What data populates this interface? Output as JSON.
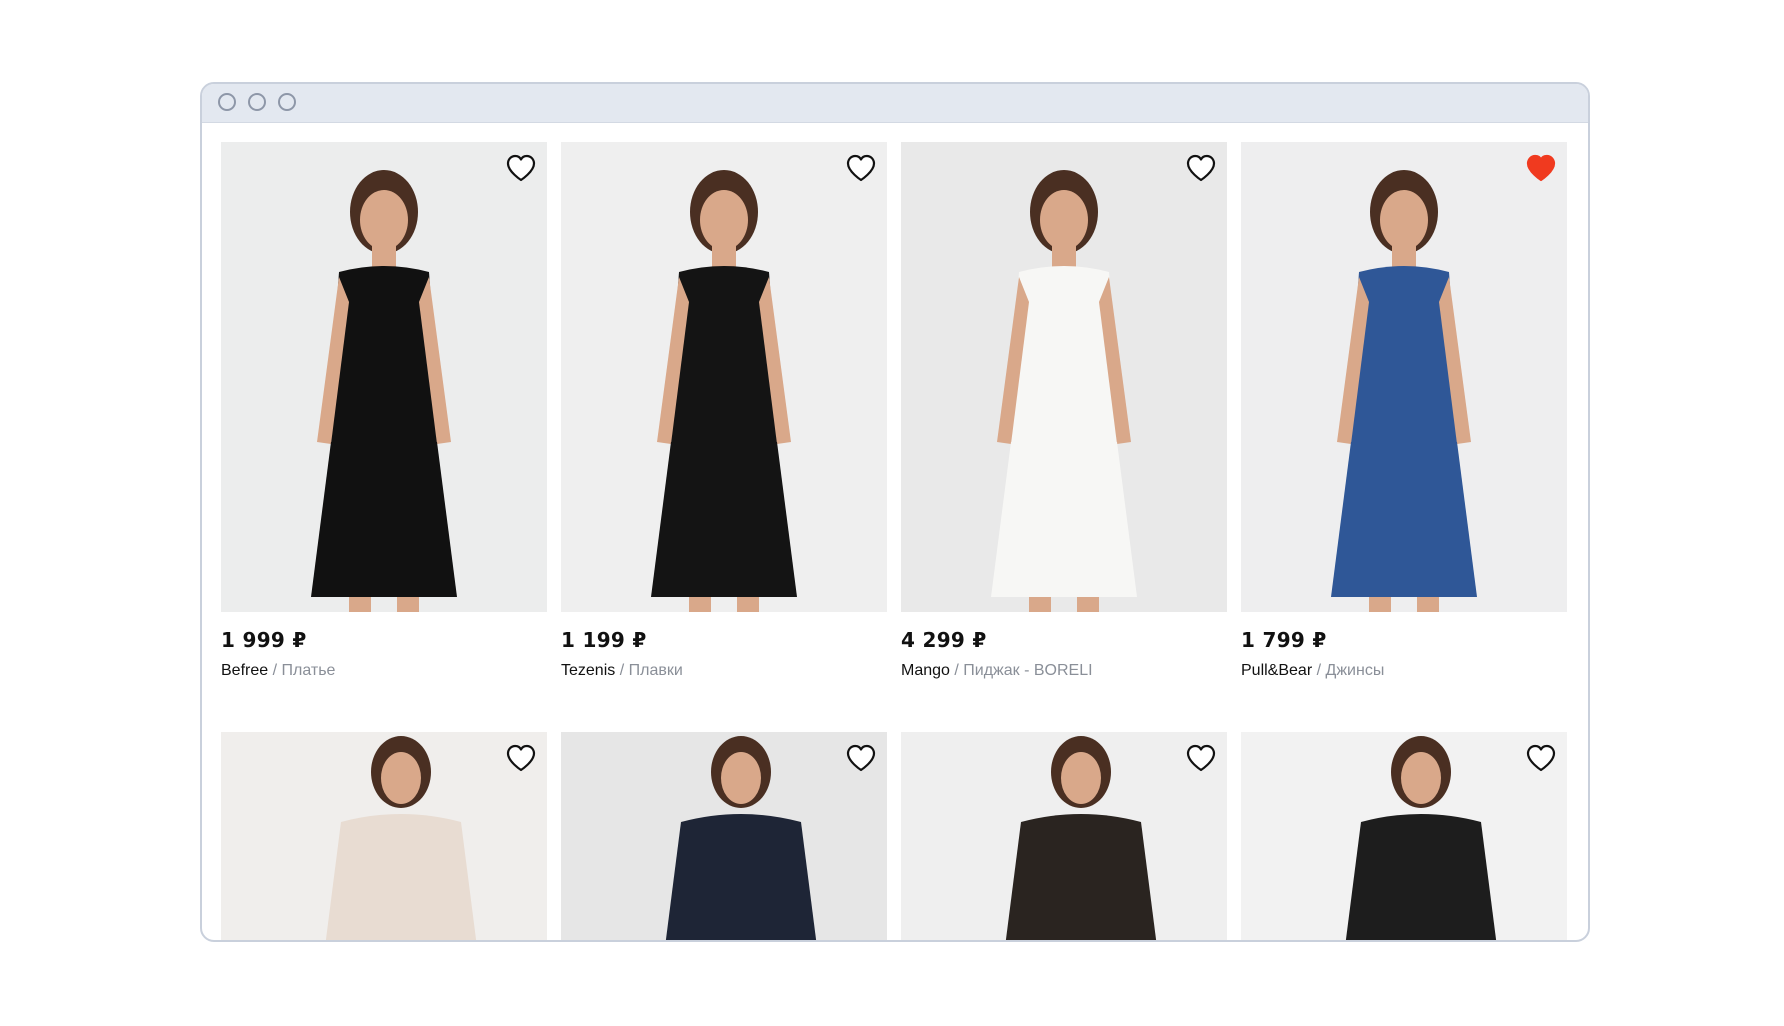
{
  "window": {
    "controls": [
      "window-dot",
      "window-dot",
      "window-dot"
    ]
  },
  "colors": {
    "titlebar": "#e3e8f0",
    "border": "#c9d0dc",
    "favorite_active": "#f03a1f",
    "muted_text": "#8a8f98"
  },
  "products": [
    {
      "price": "1 999 ₽",
      "brand": "Befree",
      "separator": "/",
      "type": "Платье",
      "favorited": false,
      "image": "black-button-dress-photo",
      "outfit_color": "#111111",
      "bg": "#eceded"
    },
    {
      "price": "1 199 ₽",
      "brand": "Tezenis",
      "separator": "/",
      "type": "Плавки",
      "favorited": false,
      "image": "black-bikini-photo",
      "outfit_color": "#141414",
      "bg": "#efefef"
    },
    {
      "price": "4 299 ₽",
      "brand": "Mango",
      "separator": "/",
      "type": "Пиджак - BORELI",
      "favorited": false,
      "image": "white-blazer-photo",
      "outfit_color": "#f7f7f5",
      "bg": "#e9e9e9"
    },
    {
      "price": "1 799 ₽",
      "brand": "Pull&Bear",
      "separator": "/",
      "type": "Джинсы",
      "favorited": true,
      "image": "blue-jeans-photo",
      "outfit_color": "#2f5797",
      "bg": "#eeeeef"
    },
    {
      "image": "beige-tshirt-photo",
      "favorited": false,
      "outfit_color": "#e8dcd2",
      "bg": "#f0eeec"
    },
    {
      "image": "navy-trousers-photo",
      "favorited": false,
      "outfit_color": "#1e2536",
      "bg": "#e6e6e6"
    },
    {
      "image": "floral-dress-photo",
      "favorited": false,
      "outfit_color": "#2a2420",
      "bg": "#efefef"
    },
    {
      "image": "floral-blouse-photo",
      "favorited": false,
      "outfit_color": "#1d1d1d",
      "bg": "#f2f2f2"
    }
  ]
}
